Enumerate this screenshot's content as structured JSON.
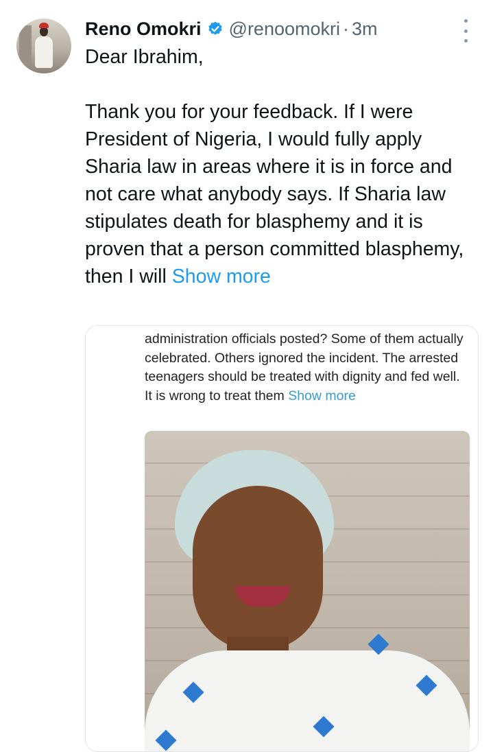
{
  "tweet": {
    "author_name": "Reno Omokri",
    "handle": "@renoomokri",
    "separator": "·",
    "time": "3m",
    "greeting": "Dear Ibrahim,",
    "body": "Thank you for your feedback. If I were President of Nigeria, I would fully apply Sharia law in areas where it is in force and not care what anybody says. If Sharia law stipulates death for blasphemy and it is proven that a person committed blasphemy, then I will",
    "show_more": "Show more"
  },
  "quoted": {
    "text": "administration officials posted? Some of them actually celebrated. Others ignored the incident. The arrested teenagers should be treated with dignity and fed well. It is wrong to treat them",
    "show_more": "Show more"
  },
  "colors": {
    "link": "#1d9bf0",
    "verified": "#1d9bf0",
    "secondary_text": "#536471"
  },
  "icons": {
    "verified": "verified-badge-icon",
    "more": "more-options-icon"
  }
}
